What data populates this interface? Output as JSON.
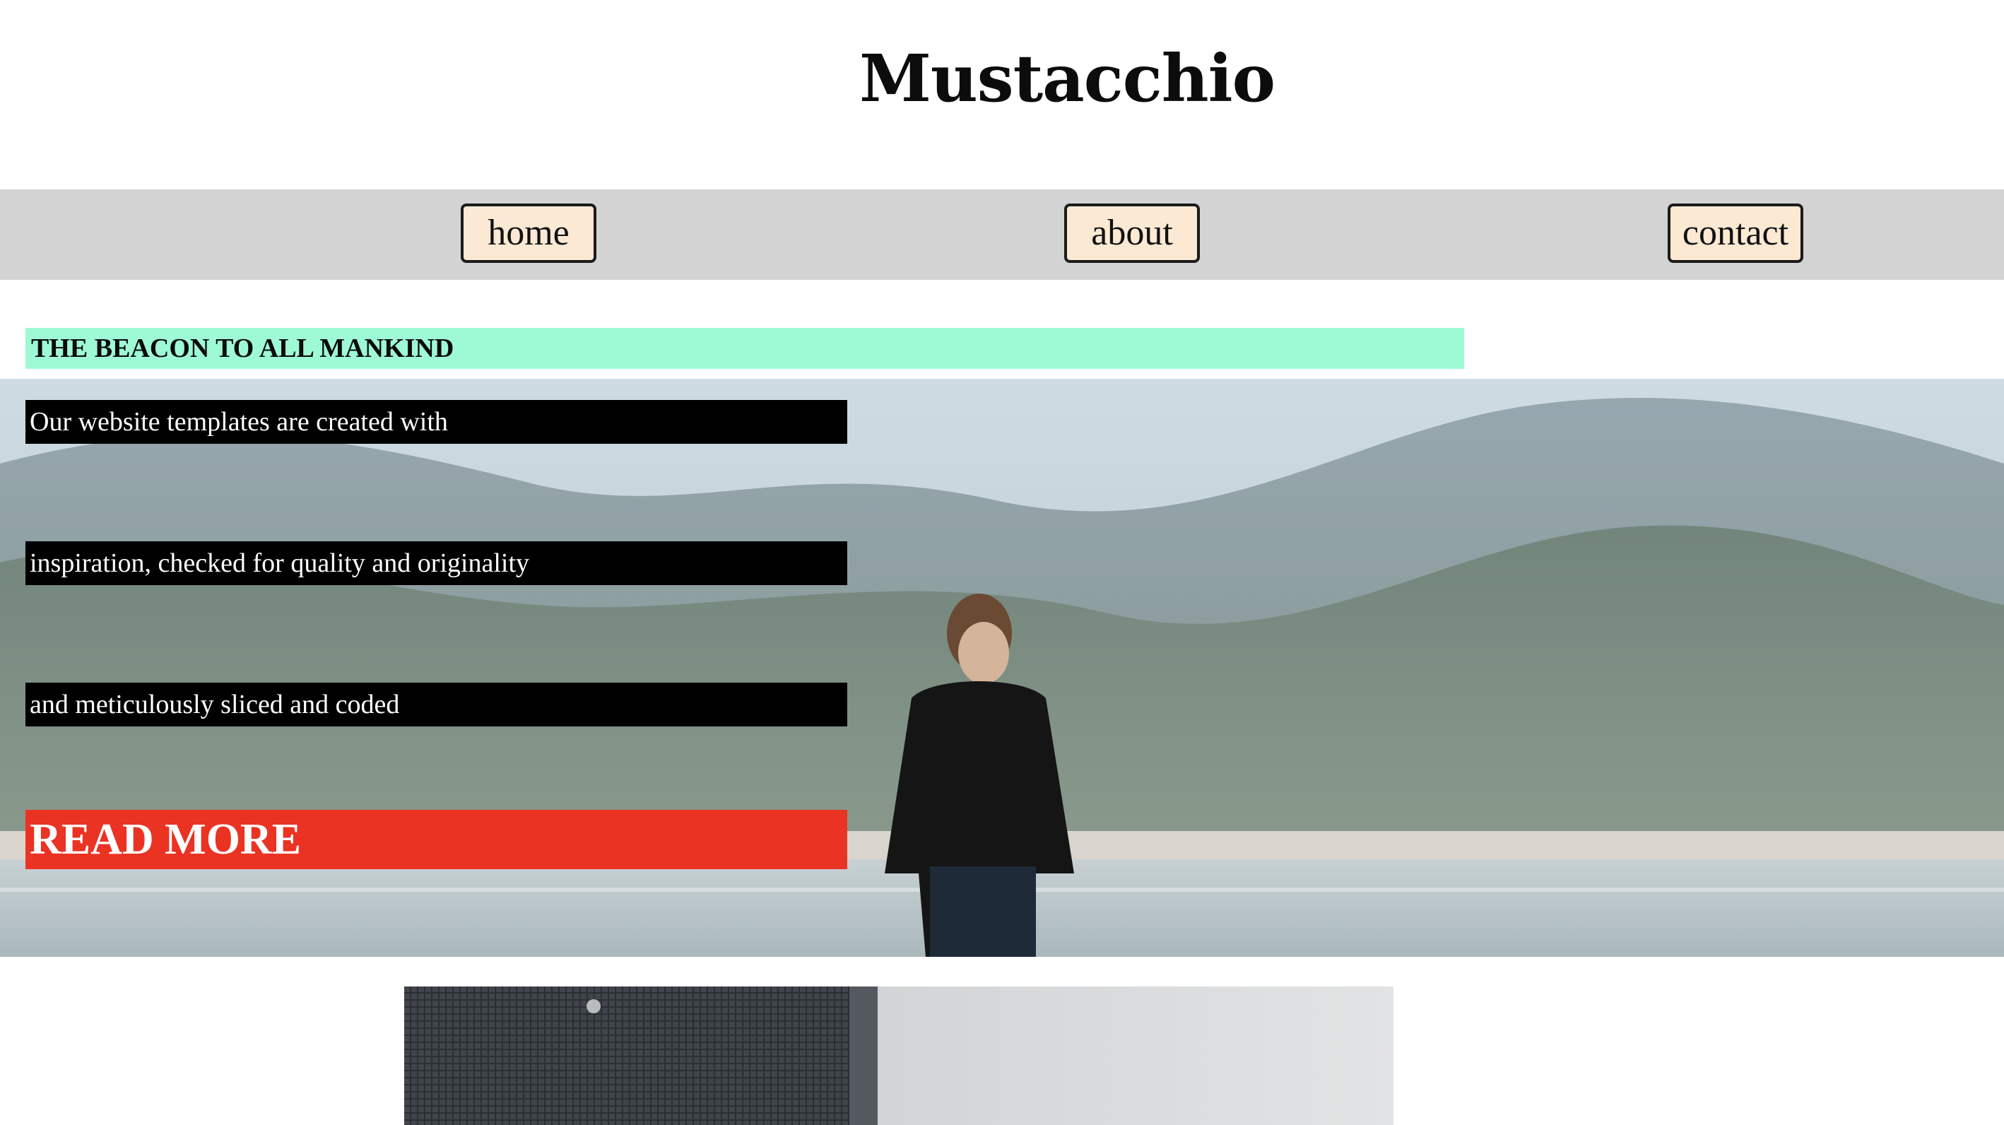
{
  "header": {
    "title": "Mustacchio"
  },
  "nav": {
    "items": [
      {
        "label": "home"
      },
      {
        "label": "about"
      },
      {
        "label": "contact"
      }
    ]
  },
  "main": {
    "tagline": "THE BEACON TO ALL MANKIND",
    "hero": {
      "lines": [
        "Our website templates are created with",
        "inspiration, checked for quality and originality",
        "and meticulously sliced and coded"
      ],
      "cta_label": "READ MORE",
      "image": "man-standing-by-lake-mountains-photo"
    },
    "second_image": "window-mesh-and-wall-photo"
  },
  "colors": {
    "nav_background": "#d3d3d3",
    "nav_button": "#fbe9d3",
    "tagline_background": "#9ef9d5",
    "hero_text_background": "#000000",
    "cta_background": "#ea3323"
  }
}
